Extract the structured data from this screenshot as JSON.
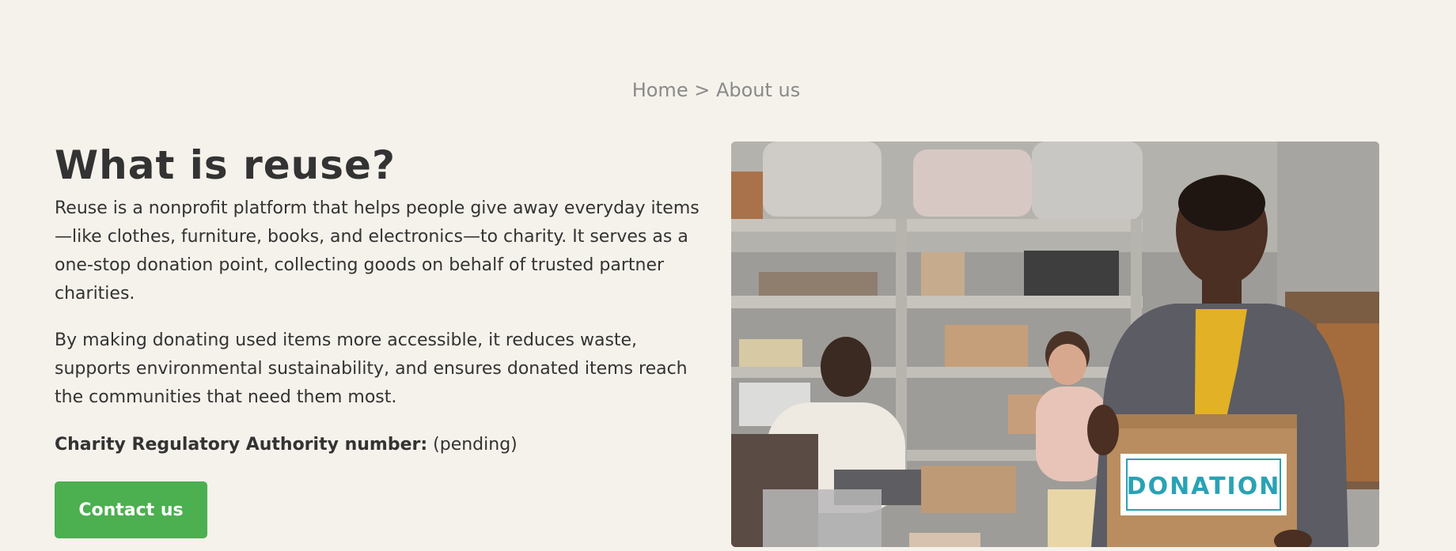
{
  "breadcrumb": {
    "home": "Home",
    "separator": ">",
    "current": "About us"
  },
  "about": {
    "title": "What is reuse?",
    "paragraph1": "Reuse is a nonprofit platform that helps people give away everyday items—like clothes, furniture, books, and electronics—to charity. It serves as a one-stop donation point, collecting goods on behalf of trusted partner charities.",
    "paragraph2": "By making donating used items more accessible, it reduces waste, supports environmental sustainability, and ensures donated items reach the communities that need them most.",
    "registration_label": "Charity Regulatory Authority number:",
    "registration_value": "(pending)",
    "contact_button": "Contact us"
  },
  "photo": {
    "box_label": "DONATION"
  },
  "colors": {
    "background": "#f5f2eb",
    "button": "#4caf50",
    "text": "#333333",
    "breadcrumb": "#8a8a8a"
  }
}
